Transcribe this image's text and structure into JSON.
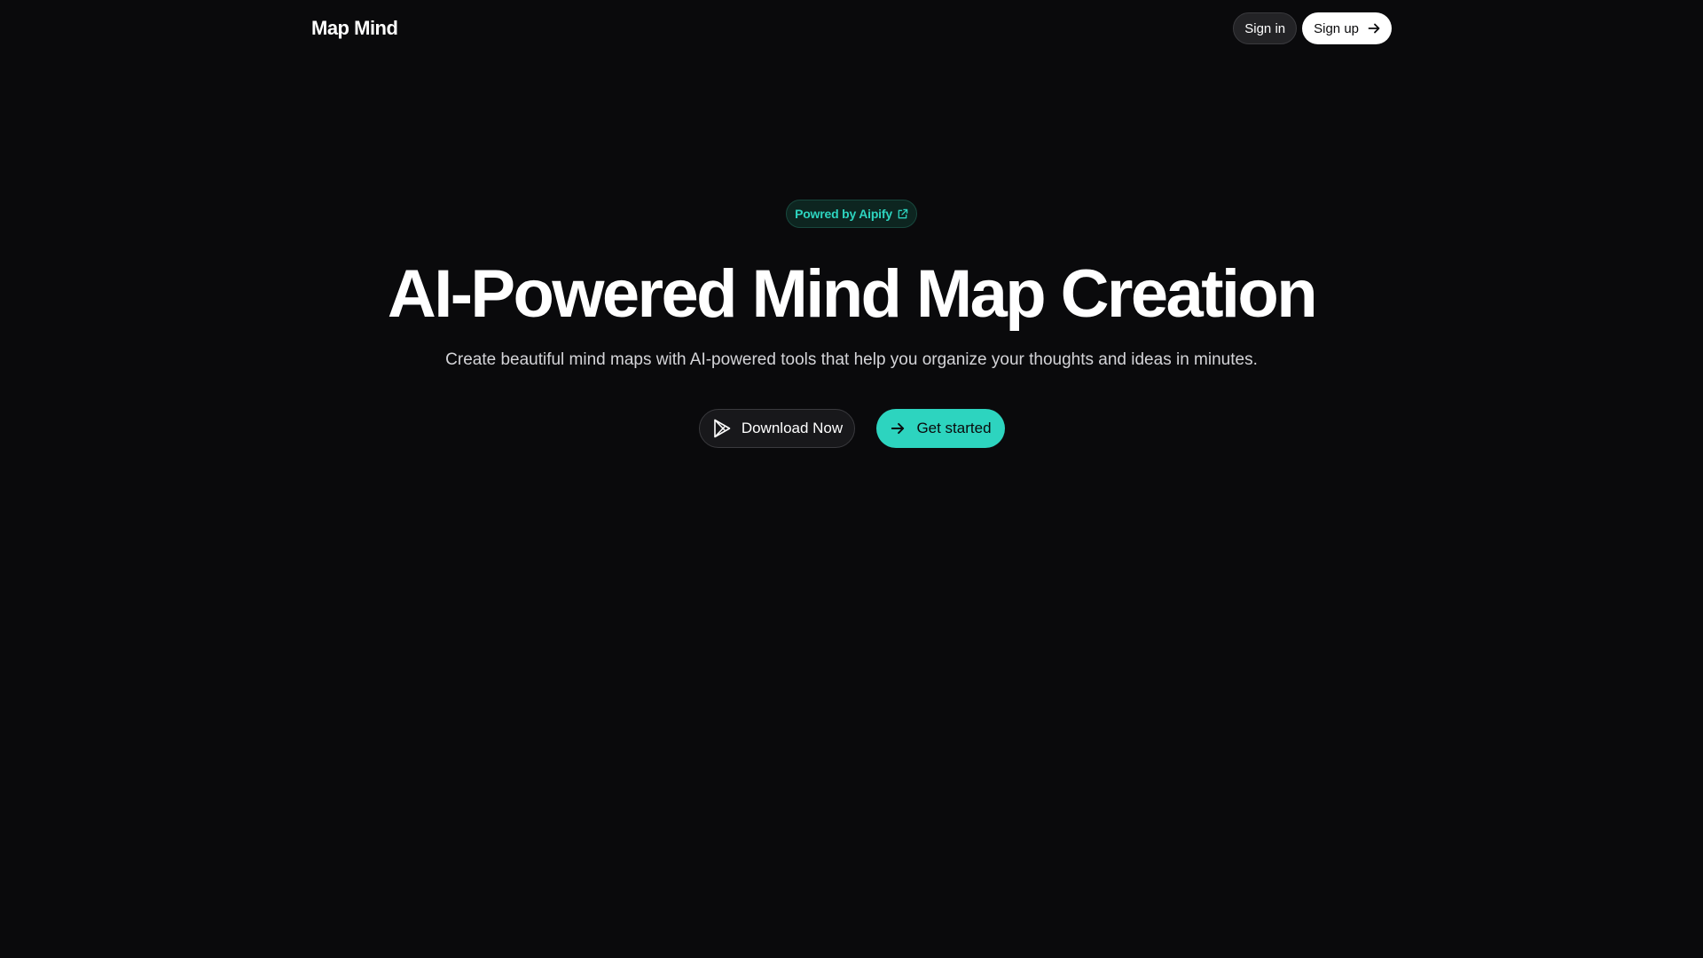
{
  "header": {
    "logo": "Map Mind",
    "sign_in_label": "Sign in",
    "sign_up_label": "Sign up"
  },
  "hero": {
    "badge_label": "Powred by Aipify",
    "title": "AI-Powered Mind Map Creation",
    "subtitle": "Create beautiful mind maps with AI-powered tools that help you organize your thoughts and ideas in minutes.",
    "download_label": "Download Now",
    "get_started_label": "Get started"
  },
  "icons": {
    "sign_up": "arrow-right-icon",
    "badge": "external-link-icon",
    "download": "play-store-icon",
    "get_started": "arrow-right-icon"
  },
  "colors": {
    "background": "#0a0a0c",
    "accent": "#2dd4bf",
    "badge_background": "#0d2520"
  }
}
